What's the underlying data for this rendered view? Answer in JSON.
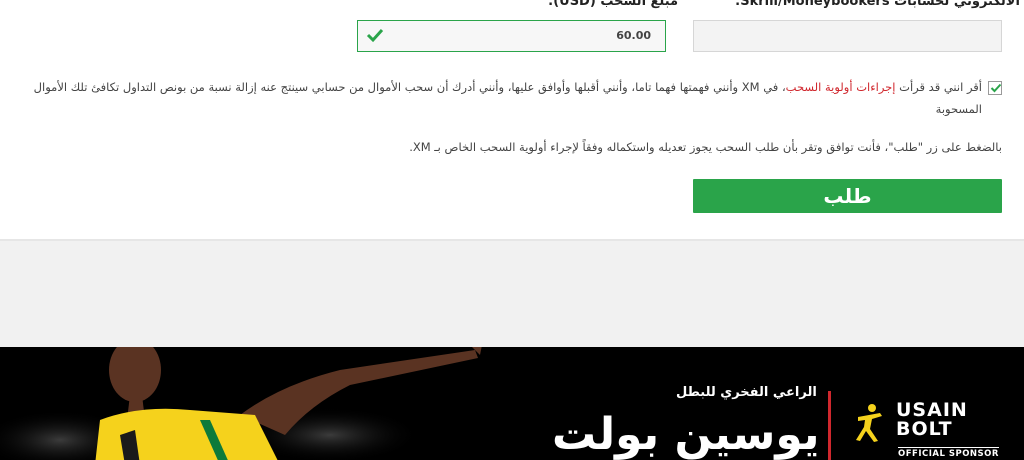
{
  "form": {
    "email_label": "البريد الالكتروني لحسابات Skrill/Moneybookers:",
    "amount_label": "مبلغ السحب (USD):",
    "email_value": "",
    "amount_value": "60.00",
    "agree_part1": "أقر انني قد قرأت ",
    "agree_link": "إجراءات أولوية السحب",
    "agree_part2": "، في XM وأنني فهمتها فهما تاما، وأنني أقبلها وأوافق عليها، وأنني أدرك أن سحب الأموال من حسابي سينتج عنه إزالة نسبة من بونص التداول تكافئ تلك الأموال المسحوبة",
    "notice": "بالضغط على زر \"طلب\"، فأنت توافق وتقر بأن طلب السحب يجوز تعديله واستكماله وفقاً لإجراء أولوية السحب الخاص بـ XM.",
    "submit_label": "طلب"
  },
  "banner": {
    "sponsor_subtitle": "الراعي الفخري للبطل",
    "athlete_name": "يوسين بولت",
    "logo_line1": "USAIN",
    "logo_line2": "BOLT",
    "sponsor_badge": "OFFICIAL SPONSOR"
  },
  "colors": {
    "accent_green": "#2aa44a",
    "link_red": "#d0282e",
    "banner_bg": "#000000"
  }
}
